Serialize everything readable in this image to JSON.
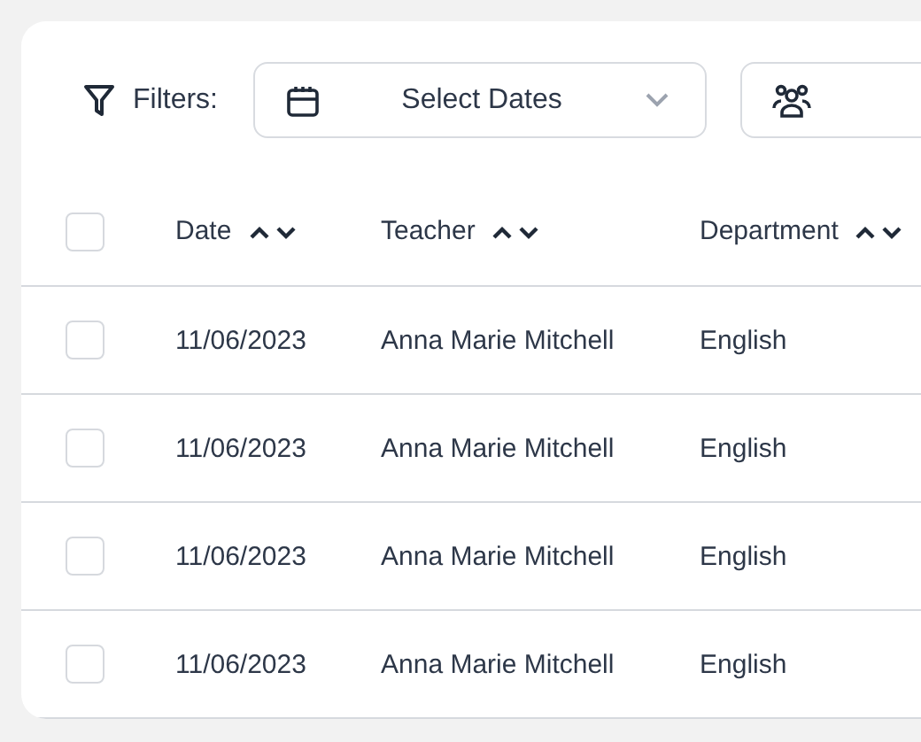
{
  "filters": {
    "label": "Filters:",
    "date_dropdown": {
      "value": "Select Dates"
    }
  },
  "table": {
    "header_checkbox": {
      "checked": false
    },
    "columns": [
      "Date",
      "Teacher",
      "Department"
    ],
    "rows": [
      {
        "checked": false,
        "date": "11/06/2023",
        "teacher": "Anna Marie Mitchell",
        "department": "English"
      },
      {
        "checked": false,
        "date": "11/06/2023",
        "teacher": "Anna Marie Mitchell",
        "department": "English"
      },
      {
        "checked": false,
        "date": "11/06/2023",
        "teacher": "Anna Marie Mitchell",
        "department": "English"
      },
      {
        "checked": false,
        "date": "11/06/2023",
        "teacher": "Anna Marie Mitchell",
        "department": "English"
      }
    ]
  }
}
